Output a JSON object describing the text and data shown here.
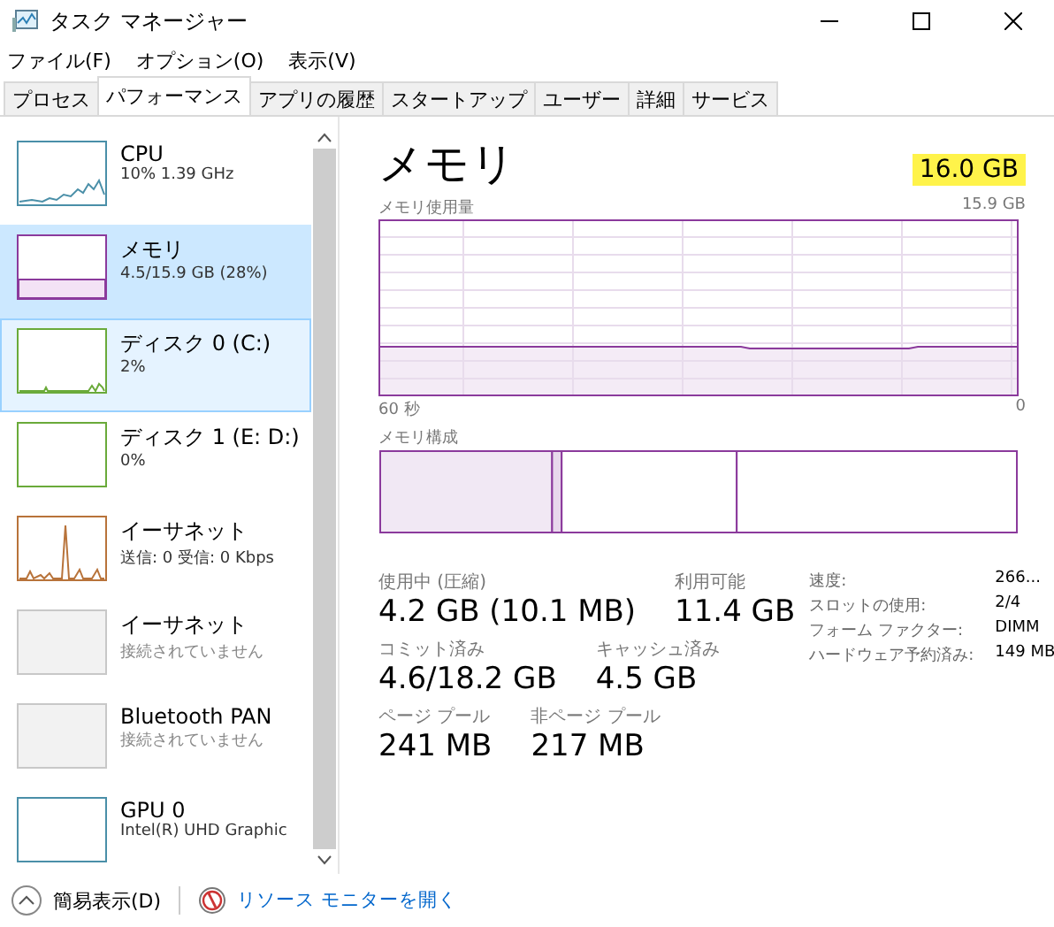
{
  "window": {
    "title": "タスク マネージャー"
  },
  "menu": [
    "ファイル(F)",
    "オプション(O)",
    "表示(V)"
  ],
  "tabs": [
    {
      "label": "プロセス",
      "selected": false
    },
    {
      "label": "パフォーマンス",
      "selected": true
    },
    {
      "label": "アプリの履歴",
      "selected": false
    },
    {
      "label": "スタートアップ",
      "selected": false
    },
    {
      "label": "ユーザー",
      "selected": false
    },
    {
      "label": "詳細",
      "selected": false
    },
    {
      "label": "サービス",
      "selected": false
    }
  ],
  "sidebar": {
    "items": [
      {
        "title": "CPU",
        "subtitle": "10%  1.39 GHz",
        "kind": "cpu",
        "color": "#4a8fa8",
        "selected": false,
        "hovered": false
      },
      {
        "title": "メモリ",
        "subtitle": "4.5/15.9 GB (28%)",
        "kind": "memory",
        "color": "#8b3a9c",
        "selected": true,
        "hovered": false
      },
      {
        "title": "ディスク 0 (C:)",
        "subtitle": "2%",
        "kind": "disk",
        "color": "#6aaa3a",
        "selected": false,
        "hovered": true
      },
      {
        "title": "ディスク 1 (E: D:)",
        "subtitle": "0%",
        "kind": "idle",
        "color": "#6aaa3a",
        "selected": false,
        "hovered": false
      },
      {
        "title": "イーサネット",
        "subtitle": "送信: 0 受信: 0 Kbps",
        "kind": "network",
        "color": "#b8733a",
        "selected": false,
        "hovered": false
      },
      {
        "title": "イーサネット",
        "subtitle": "接続されていません",
        "kind": "disconnected",
        "color": "#c8c8c8",
        "selected": false,
        "hovered": false
      },
      {
        "title": "Bluetooth PAN",
        "subtitle": "接続されていません",
        "kind": "disconnected",
        "color": "#c8c8c8",
        "selected": false,
        "hovered": false
      },
      {
        "title": "GPU 0",
        "subtitle": "Intel(R) UHD Graphic",
        "kind": "idle",
        "color": "#4a8fa8",
        "selected": false,
        "hovered": false
      }
    ]
  },
  "detail": {
    "title": "メモリ",
    "total": "16.0 GB",
    "total_highlighted": true,
    "usage_chart": {
      "label": "メモリ使用量",
      "max": "15.9 GB",
      "x_start": "60 秒",
      "x_end": "0"
    },
    "composition": {
      "label": "メモリ構成"
    },
    "stats": [
      [
        {
          "label": "使用中 (圧縮)",
          "value": "4.2 GB (10.1 MB)"
        },
        {
          "label": "利用可能",
          "value": "11.4 GB"
        }
      ],
      [
        {
          "label": "コミット済み",
          "value": "4.6/18.2 GB"
        },
        {
          "label": "キャッシュ済み",
          "value": "4.5 GB"
        }
      ],
      [
        {
          "label": "ページ プール",
          "value": "241 MB"
        },
        {
          "label": "非ページ プール",
          "value": "217 MB"
        }
      ]
    ],
    "details": [
      {
        "label": "速度:",
        "value": "266..."
      },
      {
        "label": "スロットの使用:",
        "value": "2/4"
      },
      {
        "label": "フォーム ファクター:",
        "value": "DIMM"
      },
      {
        "label": "ハードウェア予約済み:",
        "value": "149 MB"
      }
    ]
  },
  "footer": {
    "fewer_details": "簡易表示(D)",
    "link": "リソース モニターを開く"
  }
}
